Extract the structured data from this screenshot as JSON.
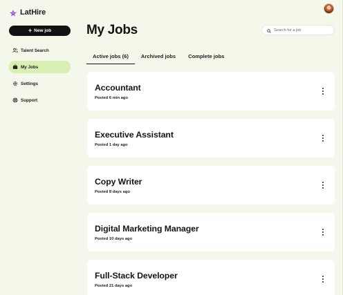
{
  "app": {
    "logo_text": "LatHire"
  },
  "sidebar": {
    "new_job_label": "New job",
    "items": [
      {
        "label": "Talent Search",
        "icon": "users-icon",
        "active": false
      },
      {
        "label": "My Jobs",
        "icon": "briefcase-icon",
        "active": true
      },
      {
        "label": "Settings",
        "icon": "gear-icon",
        "active": false
      },
      {
        "label": "Support",
        "icon": "lifebuoy-icon",
        "active": false
      }
    ]
  },
  "header": {
    "title": "My Jobs",
    "search_placeholder": "Search for a job"
  },
  "tabs": [
    {
      "label": "Active jobs (6)",
      "active": true
    },
    {
      "label": "Archived jobs",
      "active": false
    },
    {
      "label": "Complete jobs",
      "active": false
    }
  ],
  "jobs": [
    {
      "title": "Accountant",
      "posted": "Posted 6 min ago"
    },
    {
      "title": "Executive Assistant",
      "posted": "Posted 1 day ago"
    },
    {
      "title": "Copy Writer",
      "posted": "Posted 8 days ago"
    },
    {
      "title": "Digital Marketing Manager",
      "posted": "Posted 10 days ago"
    },
    {
      "title": "Full-Stack Developer",
      "posted": "Posted 21 days ago"
    }
  ],
  "colors": {
    "background": "#f4f8ea",
    "active_nav": "#d9efb3",
    "primary_button": "#111111",
    "logo_accent": "#8a3ad8"
  }
}
